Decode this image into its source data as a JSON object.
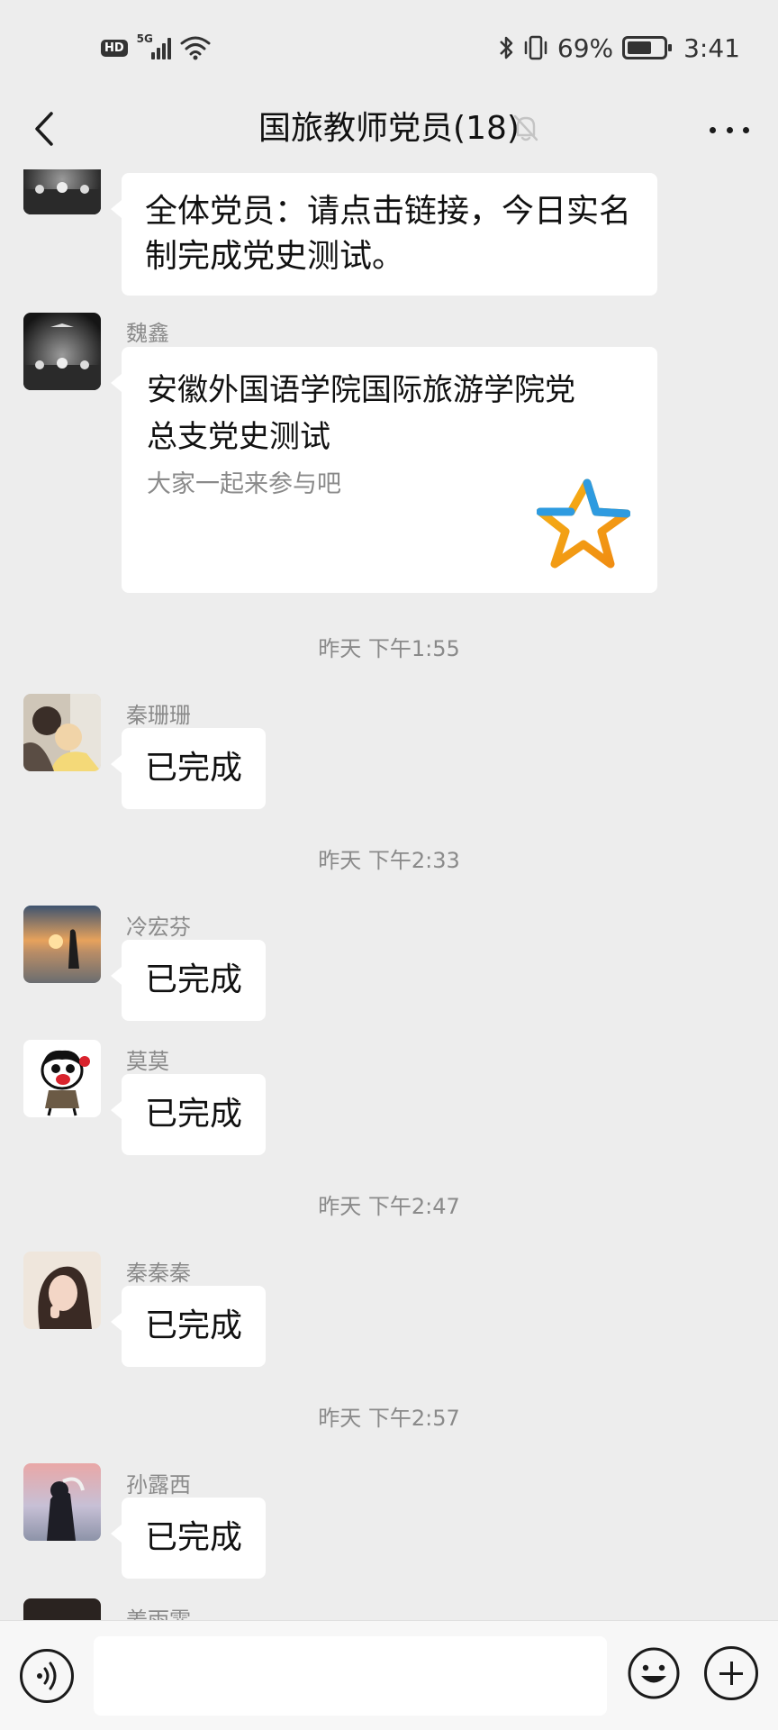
{
  "status_bar": {
    "hd": "HD",
    "network": "5G",
    "battery_pct": "69%",
    "battery_level": 0.69,
    "time": "3:41"
  },
  "header": {
    "title": "国旅教师党员(18)",
    "icons": {
      "back": "chevron-left-icon",
      "mute": "bell-muted-icon",
      "more": "more-dots-icon"
    }
  },
  "messages": [
    {
      "type": "text",
      "text_lines": [
        "全体党员：请点击链接，今日实名",
        "制完成党史测试。"
      ]
    },
    {
      "type": "link",
      "sender": "魏鑫",
      "title_lines": [
        "安徽外国语学院国际旅游学院党",
        "总支党史测试"
      ],
      "description": "大家一起来参与吧",
      "thumb_icon": "star-icon"
    },
    {
      "type": "time",
      "text": "昨天 下午1:55"
    },
    {
      "type": "text",
      "sender": "秦珊珊",
      "text": "已完成"
    },
    {
      "type": "time",
      "text": "昨天 下午2:33"
    },
    {
      "type": "text",
      "sender": "冷宏芬",
      "text": "已完成"
    },
    {
      "type": "text",
      "sender": "莫莫",
      "text": "已完成"
    },
    {
      "type": "time",
      "text": "昨天 下午2:47"
    },
    {
      "type": "text",
      "sender": "秦秦秦",
      "text": "已完成"
    },
    {
      "type": "time",
      "text": "昨天 下午2:57"
    },
    {
      "type": "text",
      "sender": "孙露西",
      "text": "已完成"
    },
    {
      "type": "partial",
      "sender": "姜雨霏"
    }
  ],
  "input_bar": {
    "placeholder": "",
    "icons": {
      "voice": "voice-icon",
      "emoji": "emoji-icon",
      "plus": "plus-icon"
    }
  }
}
